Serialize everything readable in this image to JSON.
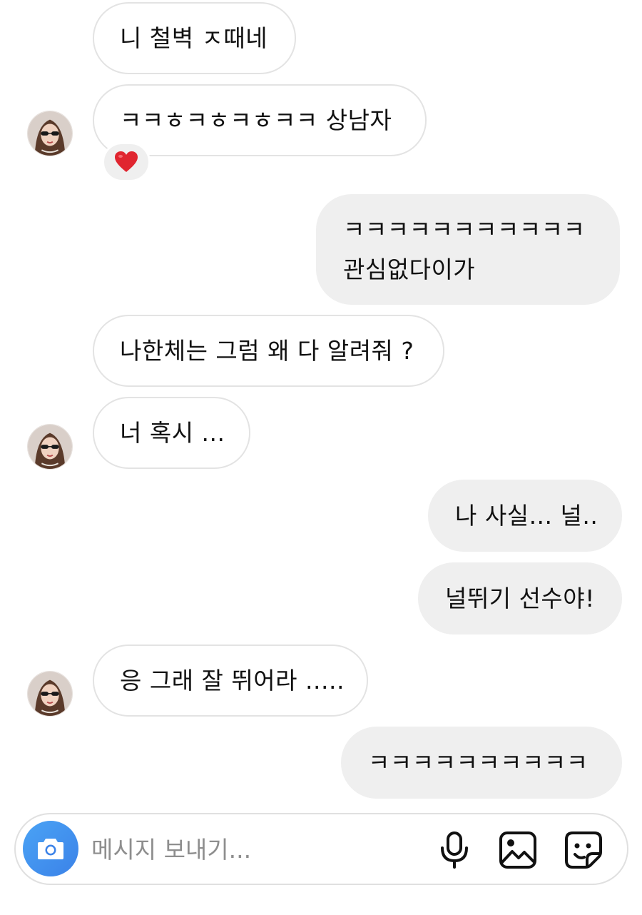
{
  "messages": [
    {
      "side": "received",
      "lines": [
        "니 철벽 ㅈ때네"
      ]
    },
    {
      "side": "received",
      "lines": [
        "ㅋㅋㅎㅋㅎㅋㅎㅋㅋ 상남자"
      ],
      "reaction": "❤️"
    },
    {
      "side": "sent",
      "lines": [
        "ㅋㅋㅋㅋㅋㅋㅋㅋㅋㅋㅋ",
        "관심없다이가"
      ]
    },
    {
      "side": "received",
      "lines": [
        "나한체는 그럼 왜 다 알려줘 ?"
      ]
    },
    {
      "side": "received",
      "lines": [
        "너 혹시 ..."
      ]
    },
    {
      "side": "sent",
      "lines": [
        "나 사실... 널.."
      ]
    },
    {
      "side": "sent",
      "lines": [
        "널뛰기 선수야!"
      ]
    },
    {
      "side": "received",
      "lines": [
        "응 그래 잘 뛰어라 ....."
      ]
    },
    {
      "side": "sent",
      "lines": [
        "ㅋㅋㅋㅋㅋㅋㅋㅋㅋㅋ"
      ]
    }
  ],
  "composer": {
    "placeholder": "메시지 보내기..."
  },
  "icons": {
    "camera": "camera-icon",
    "microphone": "microphone-icon",
    "gallery": "gallery-icon",
    "sticker": "sticker-icon",
    "reaction": "heart-icon"
  },
  "colors": {
    "received_border": "#e3e3e3",
    "sent_background": "#efefef",
    "camera_button": "#3b82e8",
    "placeholder": "#8e8e8e",
    "heart": "#e0252f"
  }
}
